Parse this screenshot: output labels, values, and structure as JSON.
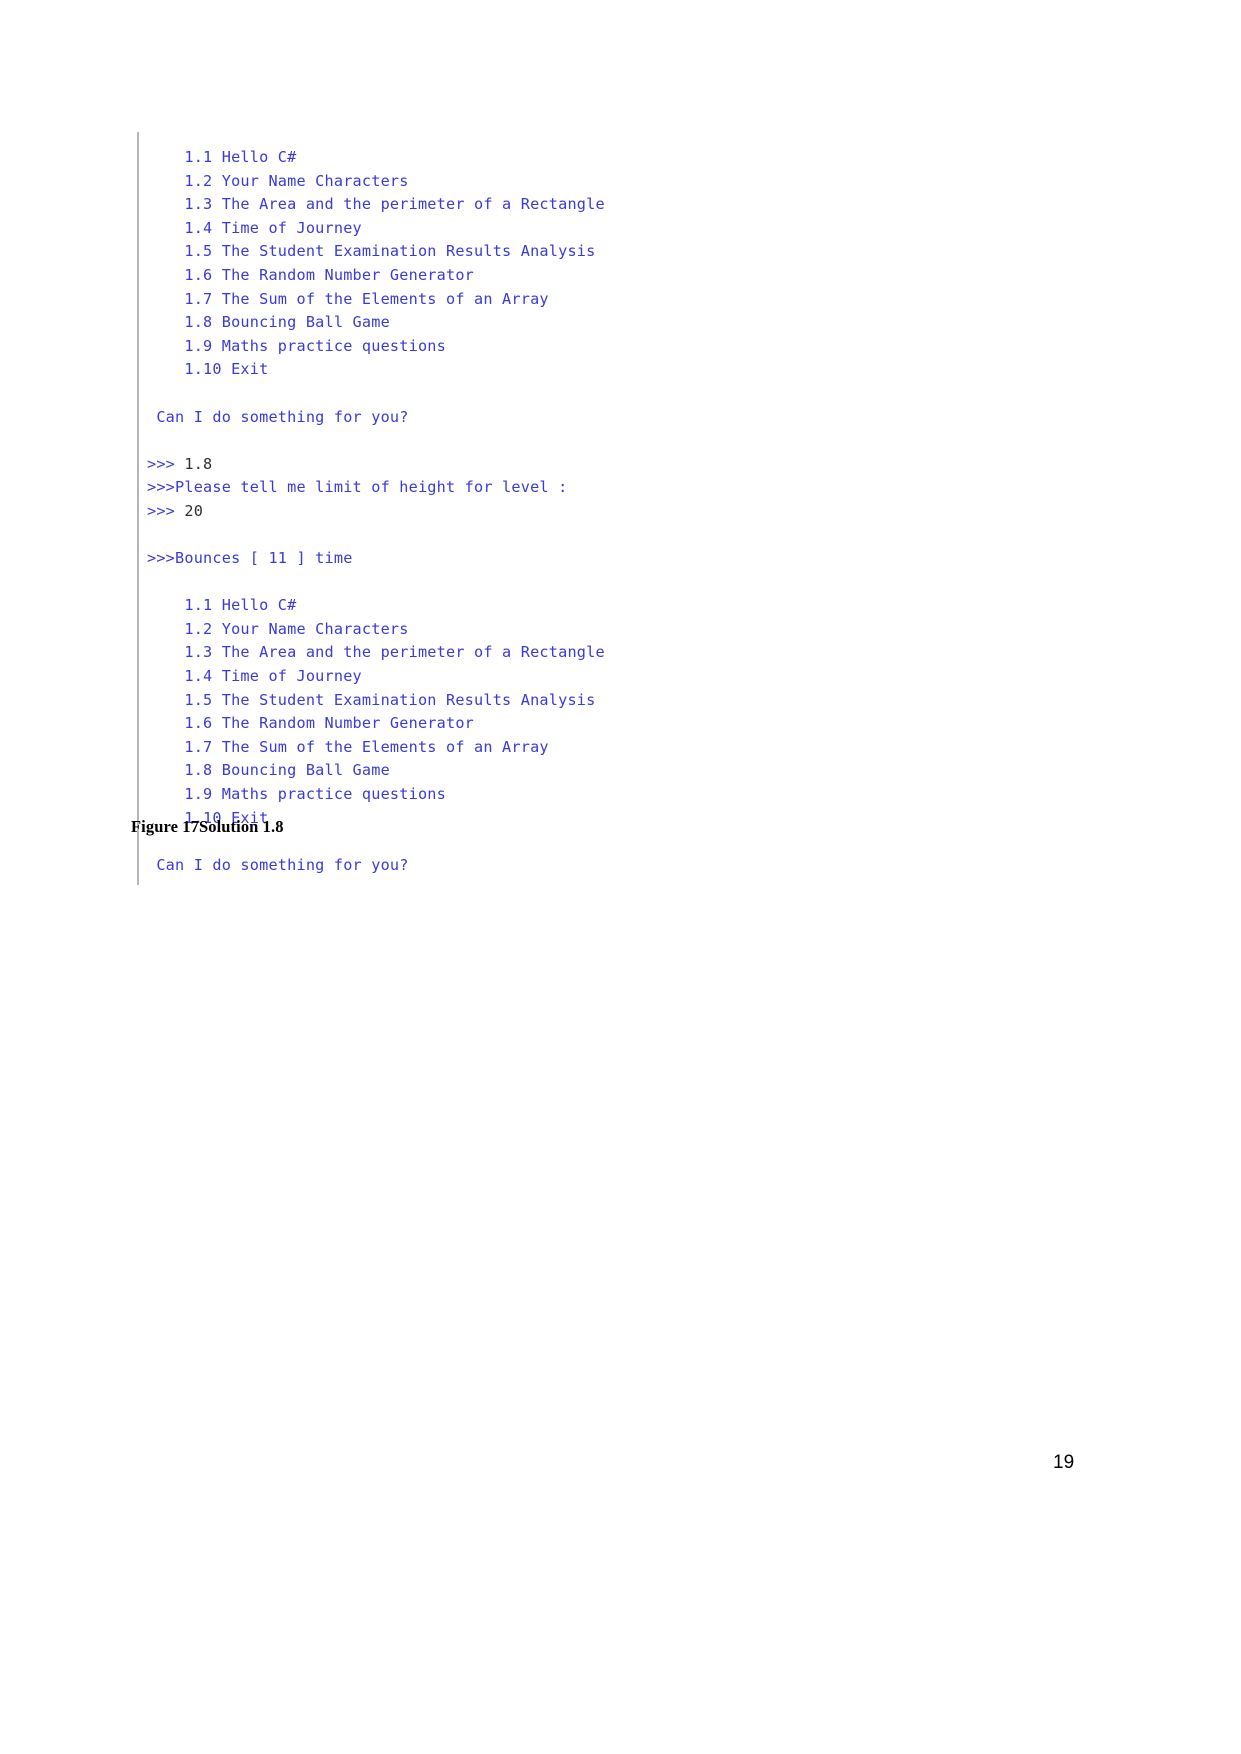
{
  "document": {
    "page_number": "19",
    "figure_caption": "Figure 17Solution 1.8"
  },
  "console": {
    "lines": [
      {
        "type": "menu",
        "text": "    1.1 Hello C#"
      },
      {
        "type": "menu",
        "text": "    1.2 Your Name Characters"
      },
      {
        "type": "menu",
        "text": "    1.3 The Area and the perimeter of a Rectangle"
      },
      {
        "type": "menu",
        "text": "    1.4 Time of Journey"
      },
      {
        "type": "menu",
        "text": "    1.5 The Student Examination Results Analysis"
      },
      {
        "type": "menu",
        "text": "    1.6 The Random Number Generator"
      },
      {
        "type": "menu",
        "text": "    1.7 The Sum of the Elements of an Array"
      },
      {
        "type": "menu",
        "text": "    1.8 Bouncing Ball Game"
      },
      {
        "type": "menu",
        "text": "    1.9 Maths practice questions"
      },
      {
        "type": "menu",
        "text": "    1.10 Exit"
      },
      {
        "type": "blank",
        "text": " "
      },
      {
        "type": "output",
        "text": " Can I do something for you?"
      },
      {
        "type": "blank",
        "text": " "
      },
      {
        "type": "input",
        "prompt": ">>> ",
        "value": "1.8"
      },
      {
        "type": "output",
        "text": ">>>Please tell me limit of height for level :"
      },
      {
        "type": "input",
        "prompt": ">>> ",
        "value": "20"
      },
      {
        "type": "blank",
        "text": " "
      },
      {
        "type": "output",
        "text": ">>>Bounces [ 11 ] time"
      },
      {
        "type": "blank",
        "text": " "
      },
      {
        "type": "menu",
        "text": "    1.1 Hello C#"
      },
      {
        "type": "menu",
        "text": "    1.2 Your Name Characters"
      },
      {
        "type": "menu",
        "text": "    1.3 The Area and the perimeter of a Rectangle"
      },
      {
        "type": "menu",
        "text": "    1.4 Time of Journey"
      },
      {
        "type": "menu",
        "text": "    1.5 The Student Examination Results Analysis"
      },
      {
        "type": "menu",
        "text": "    1.6 The Random Number Generator"
      },
      {
        "type": "menu",
        "text": "    1.7 The Sum of the Elements of an Array"
      },
      {
        "type": "menu",
        "text": "    1.8 Bouncing Ball Game"
      },
      {
        "type": "menu",
        "text": "    1.9 Maths practice questions"
      },
      {
        "type": "menu",
        "text": "    1.10 Exit"
      },
      {
        "type": "blank",
        "text": " "
      },
      {
        "type": "output",
        "text": " Can I do something for you?"
      }
    ]
  },
  "colors": {
    "console_text": "#3a3ad6",
    "user_input": "#2f2f2f",
    "border": "#b6b6b6",
    "body_text": "#000000",
    "background": "#ffffff"
  }
}
